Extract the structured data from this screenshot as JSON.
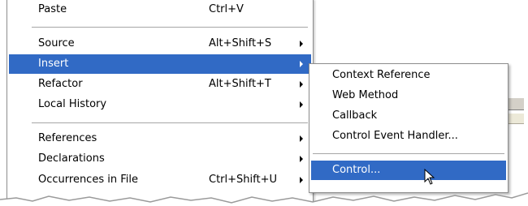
{
  "context_menu": {
    "items": [
      {
        "label": "Paste",
        "shortcut": "Ctrl+V"
      },
      {
        "label": "Source",
        "shortcut": "Alt+Shift+S"
      },
      {
        "label": "Insert",
        "shortcut": ""
      },
      {
        "label": "Refactor",
        "shortcut": "Alt+Shift+T"
      },
      {
        "label": "Local History",
        "shortcut": ""
      },
      {
        "label": "References",
        "shortcut": ""
      },
      {
        "label": "Declarations",
        "shortcut": ""
      },
      {
        "label": "Occurrences in File",
        "shortcut": "Ctrl+Shift+U"
      }
    ]
  },
  "insert_submenu": {
    "items": [
      {
        "label": "Context Reference"
      },
      {
        "label": "Web Method"
      },
      {
        "label": "Callback"
      },
      {
        "label": "Control Event Handler..."
      },
      {
        "label": "Control..."
      }
    ]
  },
  "colors": {
    "selection": "#316ac5"
  },
  "icons": [
    "submenu-arrow-icon",
    "mouse-pointer-icon"
  ]
}
